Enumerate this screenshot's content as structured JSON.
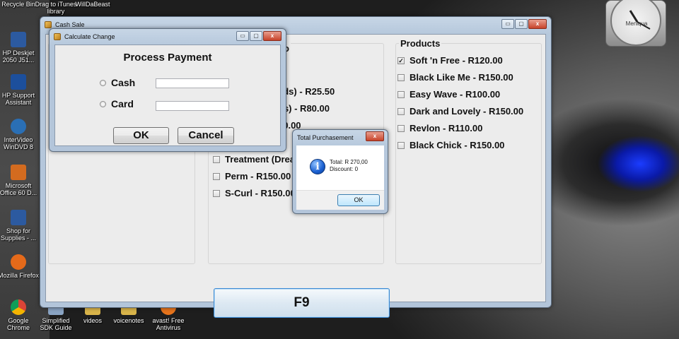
{
  "desktop": {
    "icons": [
      {
        "label": "Recycle Bin",
        "color": "#7a9bb8"
      },
      {
        "label": "Drag to iTunes library",
        "color": "#8fb1d6"
      },
      {
        "label": "WillDaBeast",
        "color": "#a8a8a8"
      },
      {
        "label": "HP Deskjet 2050 J51...",
        "color": "#2c5aa0"
      },
      {
        "label": "HP Support Assistant",
        "color": "#1c4f9c"
      },
      {
        "label": "InterVideo WinDVD 8",
        "color": "#2a6fb5"
      },
      {
        "label": "Microsoft Office 60 D...",
        "color": "#d36b1f"
      },
      {
        "label": "Shop for Supplies - ...",
        "color": "#2c5aa0"
      },
      {
        "label": "Mozilla Firefox",
        "color": "#e56a1a"
      },
      {
        "label": "Google Chrome",
        "color": "#3c9b3a"
      },
      {
        "label": "Simplified SDK Guide",
        "color": "#8aa4c4"
      },
      {
        "label": "videos",
        "color": "#d9b44a"
      },
      {
        "label": "voicenotes",
        "color": "#d9b44a"
      },
      {
        "label": "avast! Free Antivirus",
        "color": "#e6731c"
      }
    ],
    "clock_label": "Meniqua"
  },
  "cash_sale": {
    "title": "Cash Sale",
    "partial_title": "o",
    "middle_items": [
      {
        "label": "ads) - R25.50",
        "checked": false,
        "hidden_box": true
      },
      {
        "label": "ds) - R80.00",
        "checked": false,
        "hidden_box": true
      },
      {
        "label": "50.00",
        "checked": false,
        "hidden_box": true
      },
      {
        "label": "n",
        "checked": false,
        "hidden_box": false
      },
      {
        "label": "Treatment (Drea",
        "checked": false,
        "hidden_box": false
      },
      {
        "label": "Perm - R150.00",
        "checked": false,
        "hidden_box": false
      },
      {
        "label": "S-Curl - R150.00",
        "checked": false,
        "hidden_box": false
      }
    ],
    "products_title": "Products",
    "products": [
      {
        "label": "Soft 'n Free - R120.00",
        "checked": true
      },
      {
        "label": "Black Like Me - R150.00",
        "checked": false
      },
      {
        "label": "Easy Wave - R100.00",
        "checked": false
      },
      {
        "label": "Dark and Lovely - R150.00",
        "checked": false
      },
      {
        "label": "Revlon - R110.00",
        "checked": false
      },
      {
        "label": "Black Chick - R150.00",
        "checked": false
      }
    ],
    "f9_label": "F9"
  },
  "calc_change": {
    "title": "Calculate Change",
    "heading": "Process Payment",
    "cash_label": "Cash",
    "card_label": "Card",
    "cash_value": "",
    "card_value": "",
    "ok_label": "OK",
    "cancel_label": "Cancel"
  },
  "total_dialog": {
    "title": "Total Purchasement",
    "total_line": "Total: R 270,00",
    "discount_line": "Discount: 0",
    "ok_label": "OK",
    "icon": "info-icon"
  },
  "window_buttons": {
    "minimize": "▭",
    "maximize": "▢",
    "close": "x"
  }
}
